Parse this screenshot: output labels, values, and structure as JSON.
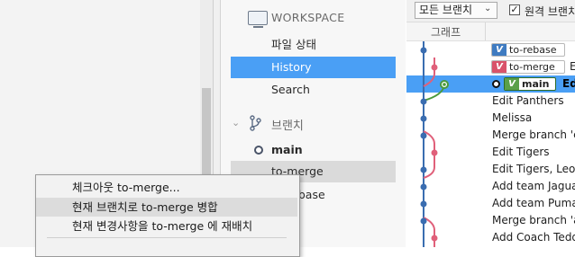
{
  "sidebar": {
    "workspace_header": "WORKSPACE",
    "items": [
      {
        "label": "파일 상태"
      },
      {
        "label": "History"
      },
      {
        "label": "Search"
      }
    ],
    "branches_header": "브랜치",
    "branches": [
      {
        "label": "main"
      },
      {
        "label": "to-merge"
      },
      {
        "label": "to-rebase"
      }
    ]
  },
  "toolbar": {
    "branch_select": "모든 브랜치",
    "remote_checkbox_label": "원격 브랜치",
    "remote_checked": true
  },
  "graph": {
    "column_header": "그래프",
    "tags": [
      {
        "label": "to-rebase",
        "color": "#3f7bc1"
      },
      {
        "label": "to-merge",
        "color": "#d9536a"
      },
      {
        "label": "main",
        "color": "#5aa04a"
      }
    ],
    "row0_suffix": "",
    "row1_suffix": "E",
    "row2_suffix": "Ed",
    "commits": [
      {
        "message": "Edit Panthers"
      },
      {
        "message": "Melissa"
      },
      {
        "message": "Merge branch 'co"
      },
      {
        "message": "Edit Tigers"
      },
      {
        "message": "Edit Tigers, Leopa"
      },
      {
        "message": "Add team Jaguars"
      },
      {
        "message": "Add team Pumas"
      },
      {
        "message": "Merge branch 'ad"
      },
      {
        "message": "Add Coach Teddy"
      }
    ]
  },
  "context_menu": {
    "items": [
      {
        "label": "체크아웃 to-merge..."
      },
      {
        "label": "현재 브랜치로 to-merge 병합"
      },
      {
        "label": "현재 변경사항을 to-merge 에 재배치"
      }
    ]
  },
  "colors": {
    "selection": "#4a9ff5",
    "hover": "#dadada",
    "graph_blue": "#3a6db0",
    "graph_pink": "#e0607a",
    "graph_green": "#4a9a3c"
  }
}
